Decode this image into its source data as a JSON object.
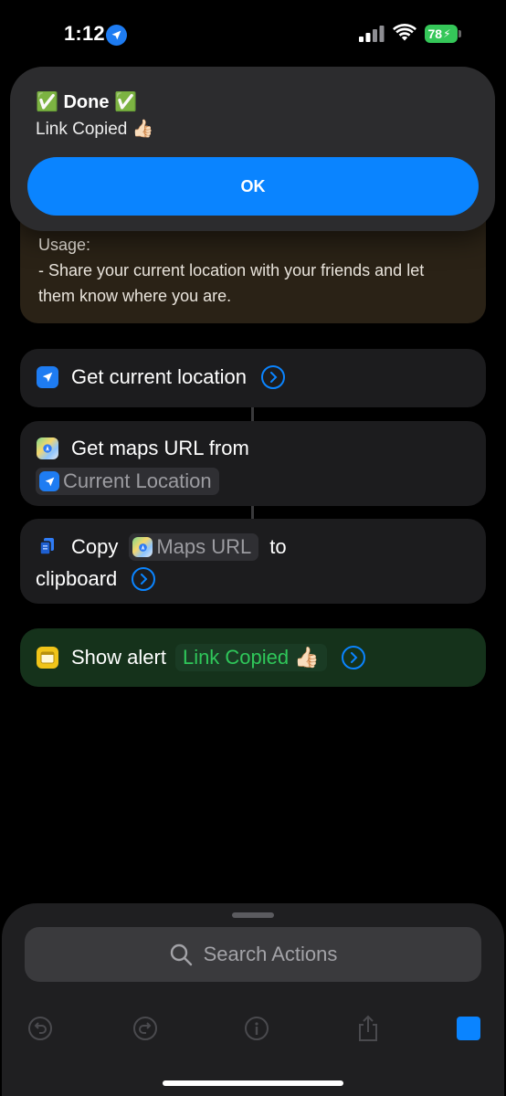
{
  "status_bar": {
    "time": "1:12",
    "battery": "78",
    "icons": [
      "location-arrow-icon",
      "signal-icon",
      "wifi-icon",
      "battery-icon"
    ]
  },
  "alert": {
    "title": "✅ Done ✅",
    "message": "Link Copied 👍🏻",
    "ok_label": "OK"
  },
  "comment": {
    "lines": [
      "Usage:",
      "- Share your current location with your friends and let",
      "them know where you are."
    ]
  },
  "actions": {
    "get_location": {
      "label": "Get current location",
      "icon": "location-arrow-icon"
    },
    "get_maps_url": {
      "label": "Get maps URL from",
      "param": "Current Location",
      "icon": "maps-icon"
    },
    "copy": {
      "label_before": "Copy",
      "param": "Maps URL",
      "label_after": "to",
      "label_line2": "clipboard",
      "icon": "copy-doc-icon"
    },
    "show_alert": {
      "label": "Show alert",
      "param": "Link Copied 👍🏻",
      "icon": "alert-icon"
    }
  },
  "bottom_sheet": {
    "search_placeholder": "Search Actions",
    "toolbar": [
      "undo-icon",
      "redo-icon",
      "info-icon",
      "share-icon",
      "play-icon"
    ]
  },
  "colors": {
    "accent": "#0a84ff",
    "background": "#000000",
    "card": "#1c1c1e",
    "comment_card": "#2a2216",
    "alert_card": "#15321b",
    "green_text": "#2fc75a"
  }
}
